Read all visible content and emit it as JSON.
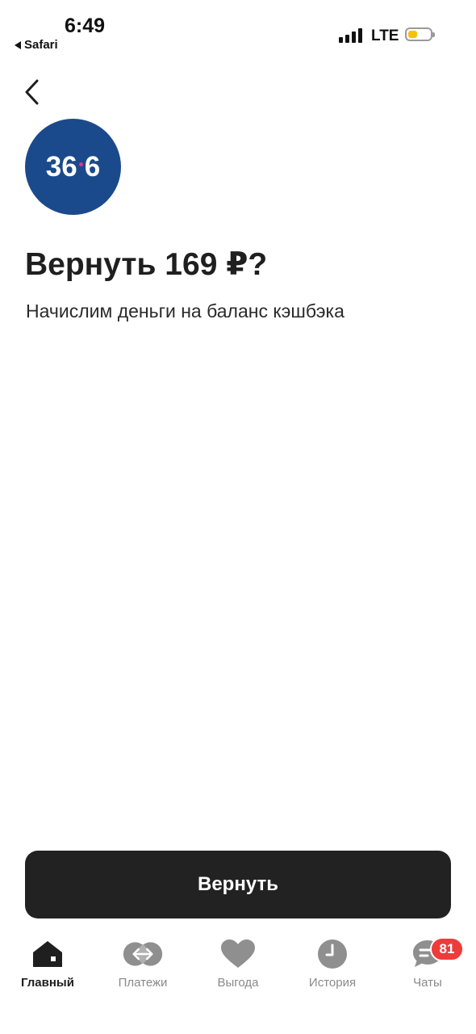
{
  "status_bar": {
    "time": "6:49",
    "back_app": "Safari",
    "network": "LTE"
  },
  "merchant": {
    "logo_text_left": "36",
    "logo_text_right": "6",
    "logo_color": "#1b4a8c",
    "logo_dot_color": "#e0319d"
  },
  "refund": {
    "title": "Вернуть 169 ₽?",
    "subtitle": "Начислим деньги на баланс кэшбэка",
    "button_label": "Вернуть"
  },
  "tabbar": {
    "items": [
      {
        "label": "Главный",
        "icon": "home-icon",
        "active": true
      },
      {
        "label": "Платежи",
        "icon": "transfer-icon",
        "active": false
      },
      {
        "label": "Выгода",
        "icon": "heart-icon",
        "active": false
      },
      {
        "label": "История",
        "icon": "clock-icon",
        "active": false
      },
      {
        "label": "Чаты",
        "icon": "chat-icon",
        "active": false
      }
    ],
    "chats_badge": "81"
  },
  "colors": {
    "button_bg": "#222222",
    "badge_bg": "#ef3b3b",
    "inactive_icon": "#8f8f8f"
  }
}
